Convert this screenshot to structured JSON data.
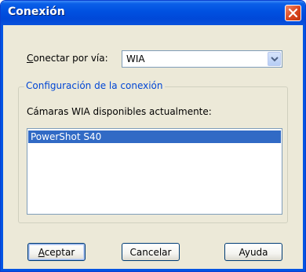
{
  "window": {
    "title": "Conexión"
  },
  "connect": {
    "label": "Conectar por vía:",
    "selected": "WIA"
  },
  "group": {
    "title": "Configuración de la conexión",
    "list_label": "Cámaras WIA disponibles actualmente:",
    "cameras": [
      "PowerShot S40"
    ]
  },
  "buttons": {
    "accept": "Aceptar",
    "cancel": "Cancelar",
    "help": "Ayuda"
  },
  "colors": {
    "titlebar": "#0054e3",
    "selection": "#316ac5",
    "group_title": "#0046d5",
    "close": "#d9441c"
  }
}
